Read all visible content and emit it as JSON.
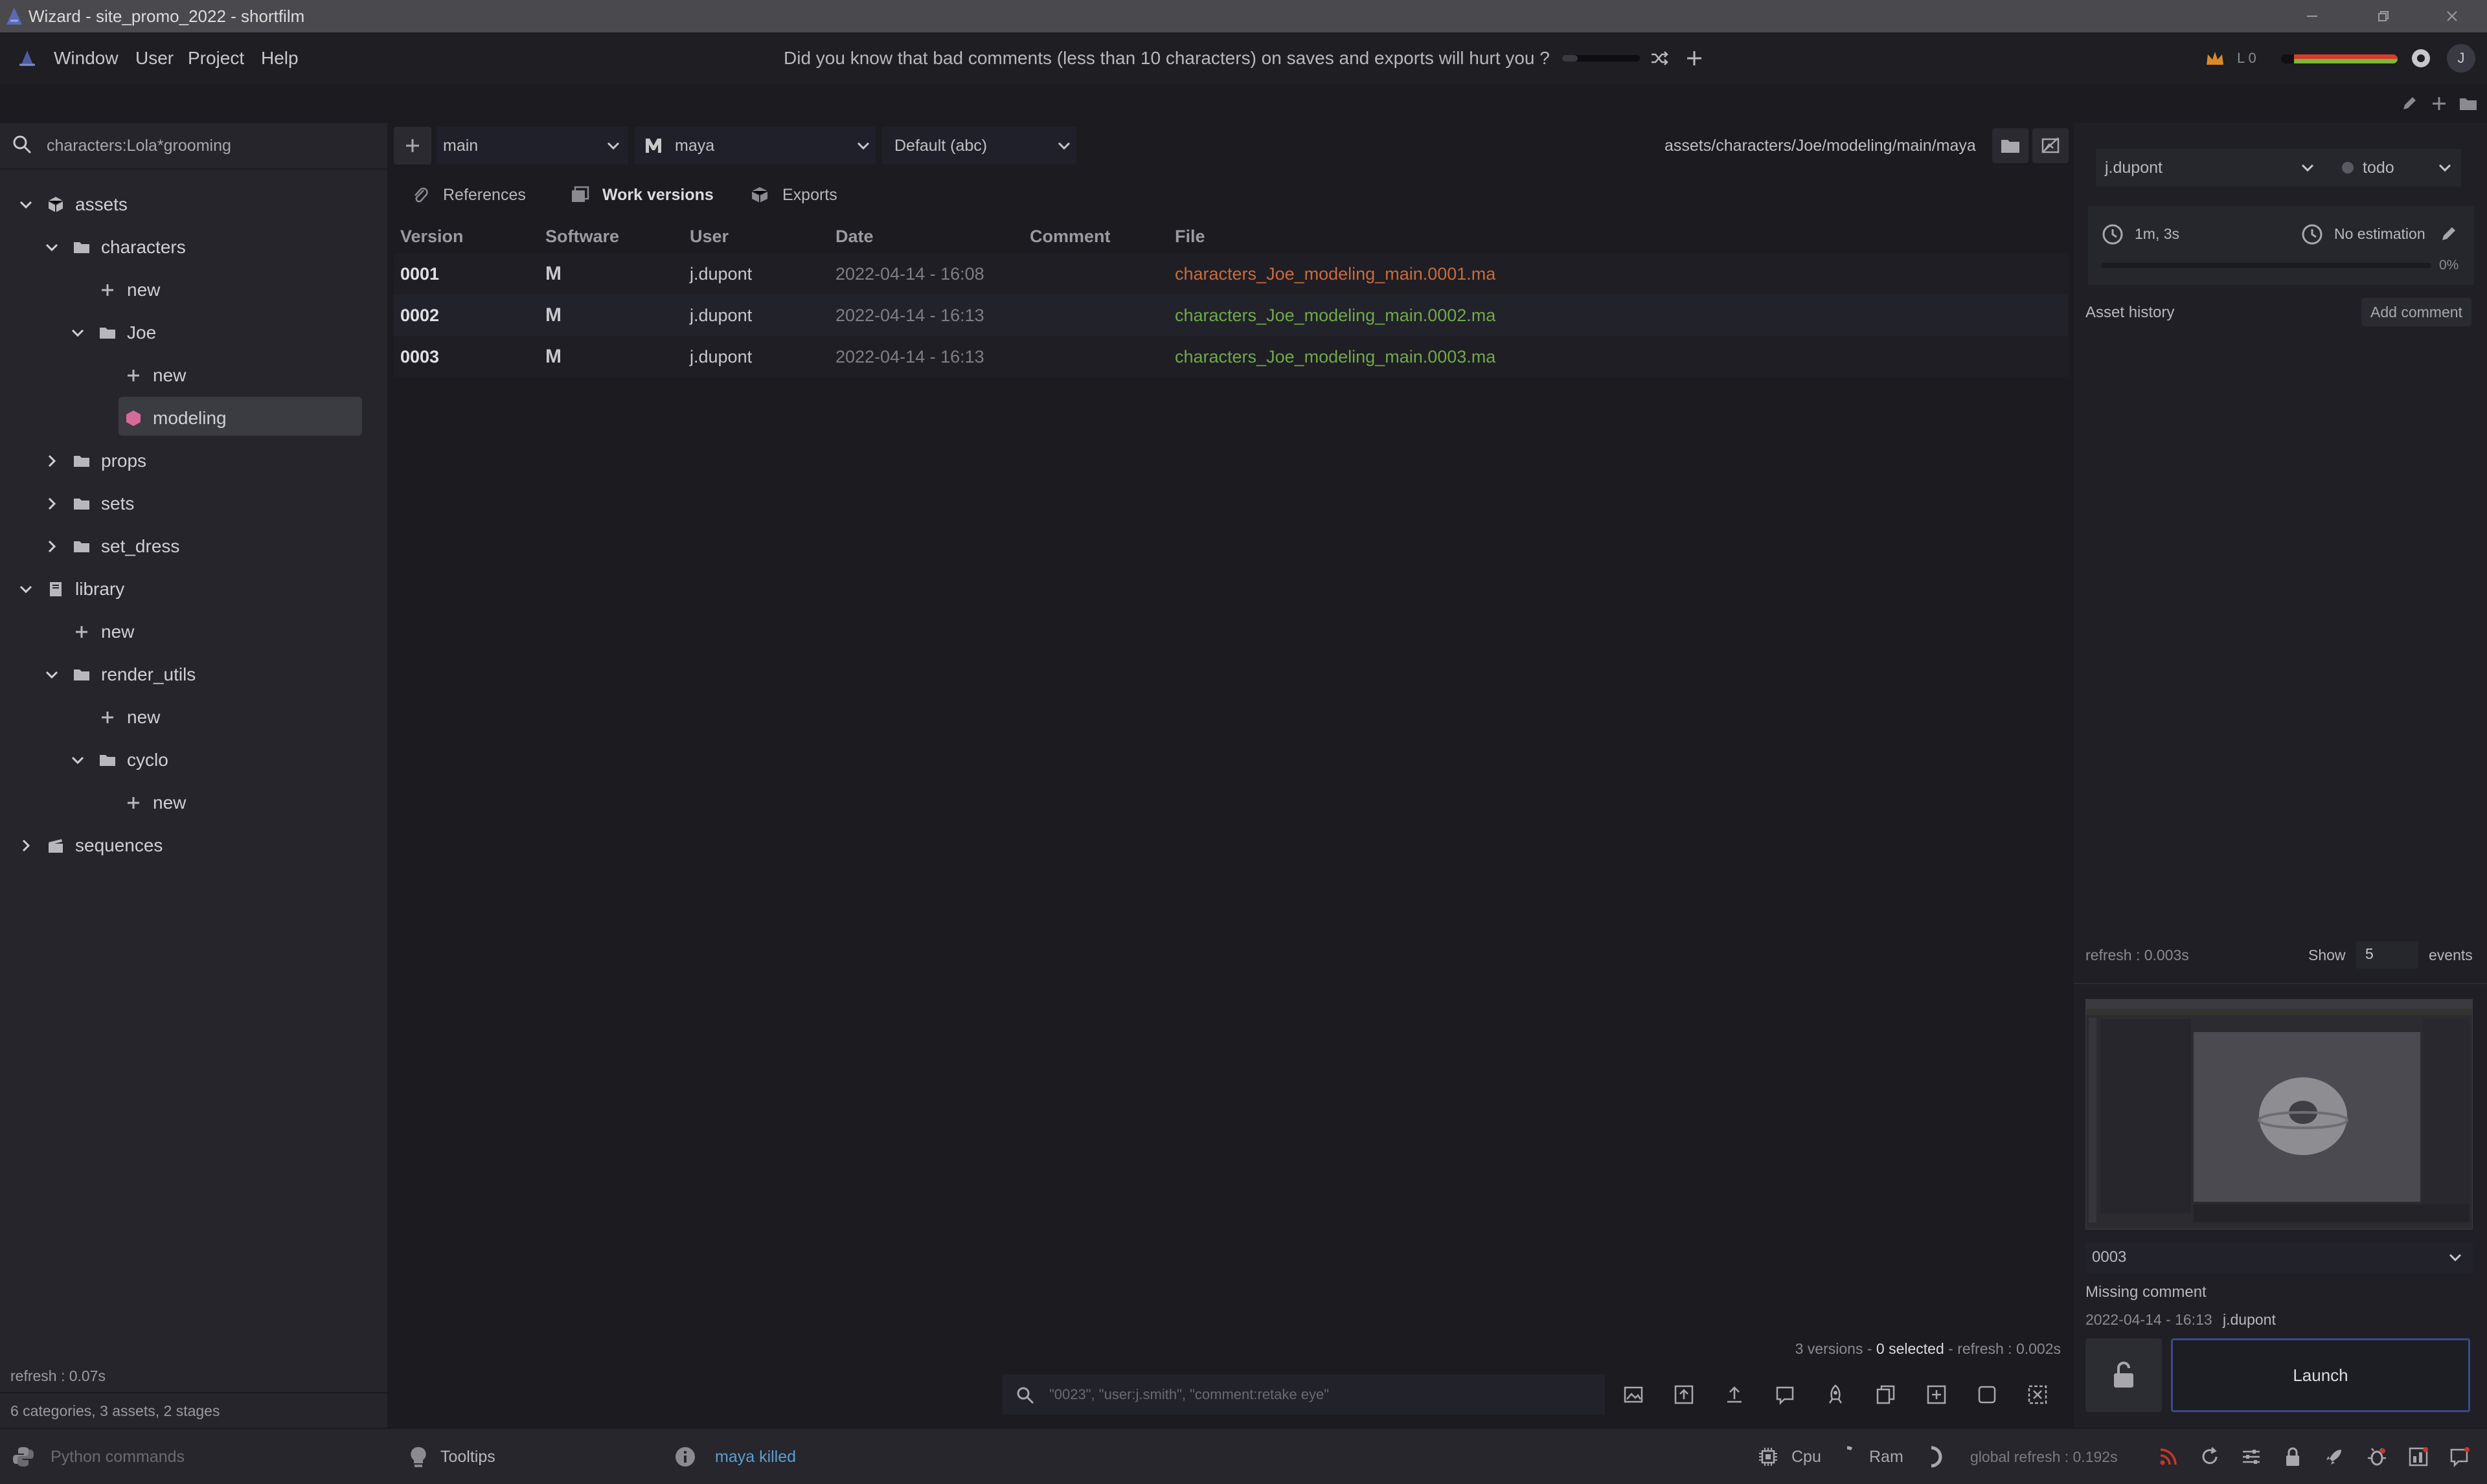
{
  "window": {
    "title": "Wizard - site_promo_2022 - shortfilm"
  },
  "menu": {
    "items": [
      "Window",
      "User",
      "Project",
      "Help"
    ],
    "tip": "Did you know that bad comments (less than 10 characters) on saves and exports will hurt you ?",
    "level": "L 0",
    "avatar": "J"
  },
  "left": {
    "search": "characters:Lola*grooming",
    "tree": [
      {
        "label": "assets",
        "depth": 0,
        "chevron": "down",
        "icon": "cube-icon"
      },
      {
        "label": "characters",
        "depth": 1,
        "chevron": "down",
        "icon": "folder-icon"
      },
      {
        "label": "new",
        "depth": 2,
        "chevron": "none",
        "icon": "plus-icon"
      },
      {
        "label": "Joe",
        "depth": 2,
        "chevron": "down",
        "icon": "folder-icon"
      },
      {
        "label": "new",
        "depth": 3,
        "chevron": "none",
        "icon": "plus-icon"
      },
      {
        "label": "modeling",
        "depth": 3,
        "chevron": "none",
        "icon": "stage-icon",
        "selected": true
      },
      {
        "label": "props",
        "depth": 1,
        "chevron": "right",
        "icon": "folder-icon"
      },
      {
        "label": "sets",
        "depth": 1,
        "chevron": "right",
        "icon": "folder-icon"
      },
      {
        "label": "set_dress",
        "depth": 1,
        "chevron": "right",
        "icon": "folder-icon"
      },
      {
        "label": "library",
        "depth": 0,
        "chevron": "down",
        "icon": "book-icon"
      },
      {
        "label": "new",
        "depth": 1,
        "chevron": "none",
        "icon": "plus-icon"
      },
      {
        "label": "render_utils",
        "depth": 1,
        "chevron": "down",
        "icon": "folder-icon"
      },
      {
        "label": "new",
        "depth": 2,
        "chevron": "none",
        "icon": "plus-icon"
      },
      {
        "label": "cyclo",
        "depth": 2,
        "chevron": "down",
        "icon": "folder-icon"
      },
      {
        "label": "new",
        "depth": 3,
        "chevron": "none",
        "icon": "plus-icon"
      },
      {
        "label": "sequences",
        "depth": 0,
        "chevron": "right",
        "icon": "clapper-icon"
      }
    ],
    "refresh": "refresh : 0.07s",
    "summary": "6 categories, 3 assets, 2 stages"
  },
  "main": {
    "variant": "main",
    "software": "maya",
    "export_format": "Default (abc)",
    "path": "assets/characters/Joe/modeling/main/maya",
    "tabs": [
      "References",
      "Work versions",
      "Exports"
    ],
    "active_tab": "Work versions",
    "columns": [
      "Version",
      "Software",
      "User",
      "Date",
      "Comment",
      "File"
    ],
    "rows": [
      {
        "version": "0001",
        "software": "M",
        "user": "j.dupont",
        "date": "2022-04-14 - 16:08",
        "comment": "",
        "file": "characters_Joe_modeling_main.0001.ma",
        "file_color": "#c96a3e"
      },
      {
        "version": "0002",
        "software": "M",
        "user": "j.dupont",
        "date": "2022-04-14 - 16:13",
        "comment": "",
        "file": "characters_Joe_modeling_main.0002.ma",
        "file_color": "#6fa94a"
      },
      {
        "version": "0003",
        "software": "M",
        "user": "j.dupont",
        "date": "2022-04-14 - 16:13",
        "comment": "",
        "file": "characters_Joe_modeling_main.0003.ma",
        "file_color": "#6fa94a"
      }
    ],
    "status": {
      "versions": "3 versions - ",
      "selected": "0 selected",
      "refresh": " - refresh : 0.002s"
    },
    "search_placeholder": "\"0023\", \"user:j.smith\", \"comment:retake eye\""
  },
  "right": {
    "assignee": "j.dupont",
    "state": "todo",
    "time_spent": "1m, 3s",
    "estimation": "No estimation",
    "progress": "0%",
    "history_label": "Asset history",
    "add_comment": "Add comment",
    "refresh": "refresh : 0.003s",
    "show_label": "Show",
    "show_count": "5",
    "events_label": "events",
    "version_select": "0003",
    "version_comment": "Missing comment",
    "version_date": "2022-04-14 - 16:13",
    "version_user": "j.dupont",
    "launch": "Launch"
  },
  "bottom": {
    "python": "Python commands",
    "tooltips": "Tooltips",
    "message": "maya killed",
    "cpu": "Cpu",
    "ram": "Ram",
    "global_refresh": "global refresh : 0.192s"
  },
  "colors": {
    "accent": "#3a4a8a",
    "file_orange": "#c96a3e",
    "file_green": "#6fa94a",
    "message_blue": "#5a9fd4",
    "stage_pink": "#d86a9a"
  }
}
